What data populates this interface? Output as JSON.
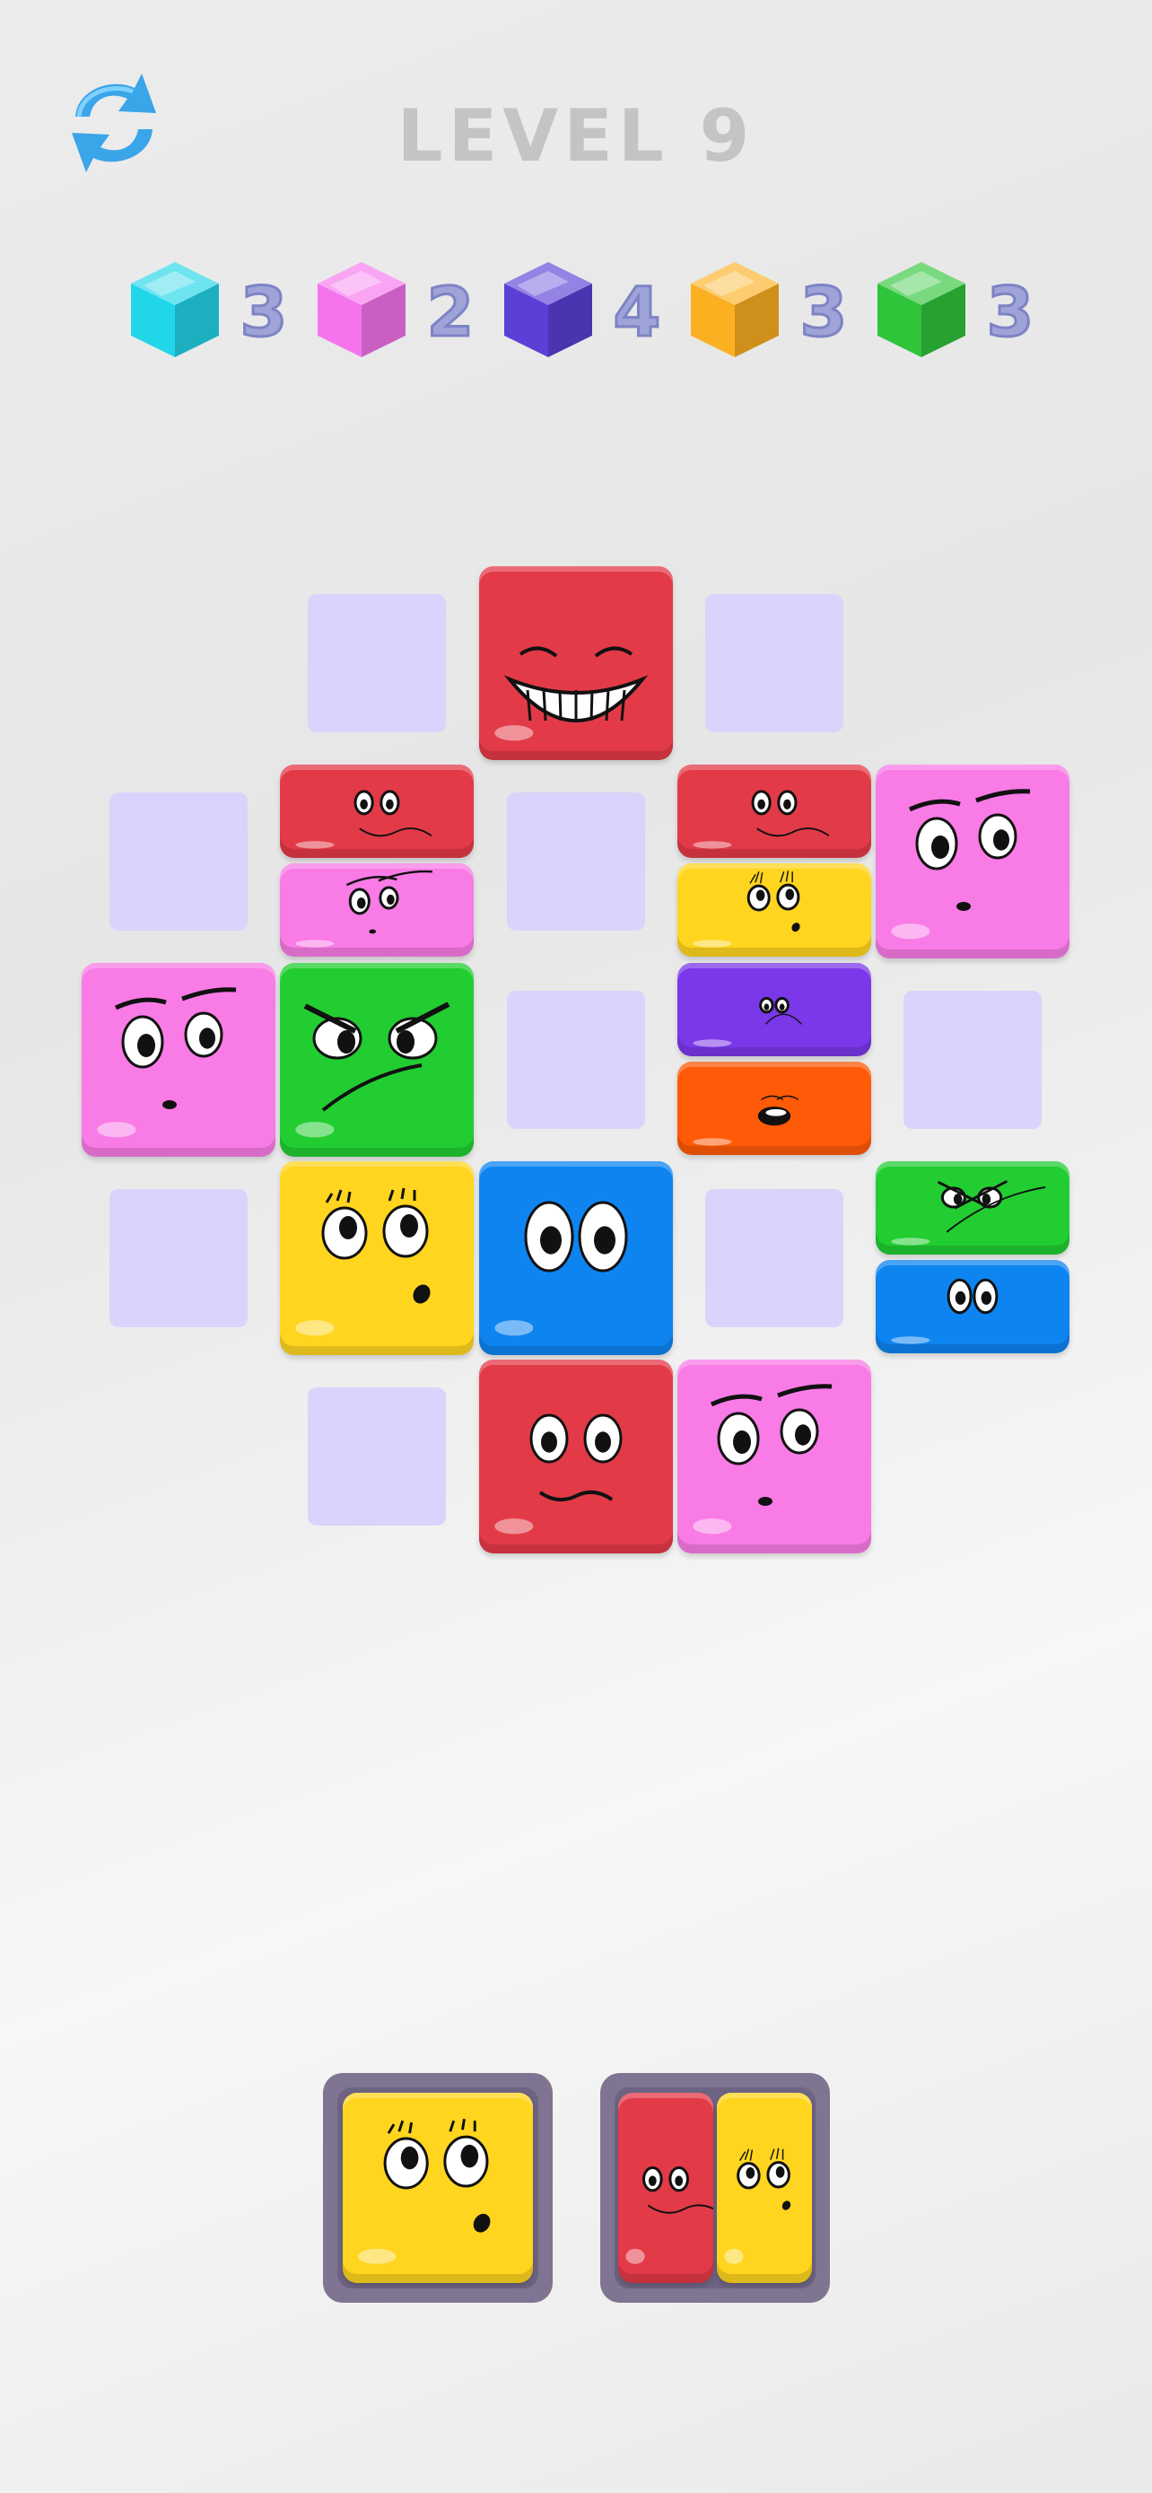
{
  "header": {
    "restart_icon": "restart-arrows-icon",
    "title": "LEVEL 9"
  },
  "goals": [
    {
      "color": "#22d6ea",
      "count": "3",
      "name": "cyan"
    },
    {
      "color": "#f574ee",
      "count": "2",
      "name": "pink"
    },
    {
      "color": "#5b3fd6",
      "count": "4",
      "name": "purple"
    },
    {
      "color": "#fbb021",
      "count": "3",
      "name": "orange"
    },
    {
      "color": "#2fc43a",
      "count": "3",
      "name": "green"
    }
  ],
  "colors": {
    "red": "#e33a48",
    "pink": "#f97be6",
    "green": "#22cd32",
    "yellow": "#ffd51f",
    "blue": "#0e84f0",
    "purple": "#7a38e8",
    "orange": "#ff5a08",
    "slot": "#d9d4fb",
    "tray": "#7f7592"
  },
  "board": {
    "empty_slots": 9,
    "tiles": [
      {
        "cell": "r0c2",
        "color": "red",
        "face": "grin"
      },
      {
        "cell": "r1c1-top",
        "color": "red",
        "face": "smile-small"
      },
      {
        "cell": "r1c1-bottom",
        "color": "pink",
        "face": "skeptical-small"
      },
      {
        "cell": "r1c3-top",
        "color": "red",
        "face": "smile-small"
      },
      {
        "cell": "r1c3-bottom",
        "color": "yellow",
        "face": "surprised-small"
      },
      {
        "cell": "r1c4",
        "color": "pink",
        "face": "skeptical"
      },
      {
        "cell": "r2c0",
        "color": "pink",
        "face": "skeptical"
      },
      {
        "cell": "r2c1",
        "color": "green",
        "face": "angry"
      },
      {
        "cell": "r2c3-top",
        "color": "purple",
        "face": "sad-small"
      },
      {
        "cell": "r2c3-bottom",
        "color": "orange",
        "face": "scream-small"
      },
      {
        "cell": "r3c1",
        "color": "yellow",
        "face": "surprised"
      },
      {
        "cell": "r3c2",
        "color": "blue",
        "face": "stare"
      },
      {
        "cell": "r3c4-top",
        "color": "green",
        "face": "angry-small"
      },
      {
        "cell": "r3c4-bottom",
        "color": "blue",
        "face": "stare-small"
      },
      {
        "cell": "r4c2",
        "color": "red",
        "face": "smile"
      },
      {
        "cell": "r4c3",
        "color": "pink",
        "face": "skeptical"
      }
    ]
  },
  "trays": [
    {
      "pieces": [
        {
          "color": "yellow",
          "face": "surprised"
        }
      ]
    },
    {
      "pieces": [
        {
          "color": "red",
          "face": "smile-small"
        },
        {
          "color": "yellow",
          "face": "surprised-small"
        }
      ]
    }
  ]
}
